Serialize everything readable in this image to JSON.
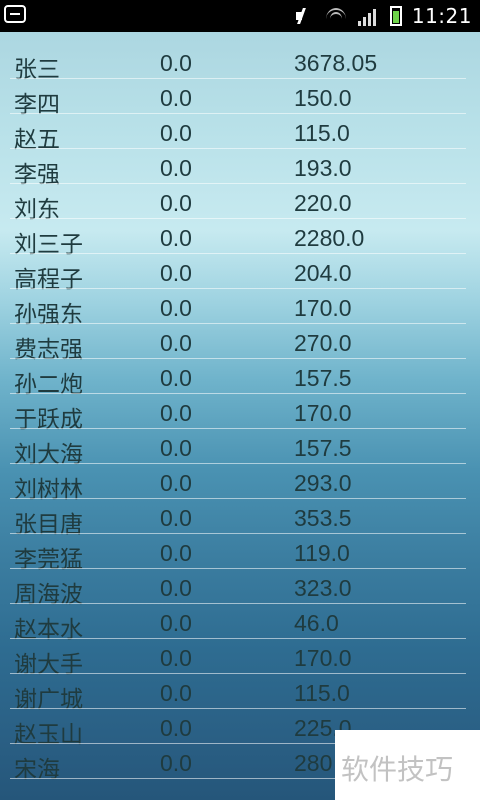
{
  "status_bar": {
    "time": "11:21"
  },
  "rows": [
    {
      "name": "张三",
      "v1": "0.0",
      "v2": "3678.05"
    },
    {
      "name": "李四",
      "v1": "0.0",
      "v2": "150.0"
    },
    {
      "name": "赵五",
      "v1": "0.0",
      "v2": "115.0"
    },
    {
      "name": "李强",
      "v1": "0.0",
      "v2": "193.0"
    },
    {
      "name": "刘东",
      "v1": "0.0",
      "v2": "220.0"
    },
    {
      "name": "刘三子",
      "v1": "0.0",
      "v2": "2280.0"
    },
    {
      "name": "高程子",
      "v1": "0.0",
      "v2": "204.0"
    },
    {
      "name": "孙强东",
      "v1": "0.0",
      "v2": "170.0"
    },
    {
      "name": "费志强",
      "v1": "0.0",
      "v2": "270.0"
    },
    {
      "name": "孙二炮",
      "v1": "0.0",
      "v2": "157.5"
    },
    {
      "name": "于跃成",
      "v1": "0.0",
      "v2": "170.0"
    },
    {
      "name": "刘大海",
      "v1": "0.0",
      "v2": "157.5"
    },
    {
      "name": "刘树林",
      "v1": "0.0",
      "v2": "293.0"
    },
    {
      "name": "张目唐",
      "v1": "0.0",
      "v2": "353.5"
    },
    {
      "name": "李莞猛",
      "v1": "0.0",
      "v2": "119.0"
    },
    {
      "name": "周海波",
      "v1": "0.0",
      "v2": "323.0"
    },
    {
      "name": "赵本水",
      "v1": "0.0",
      "v2": "46.0"
    },
    {
      "name": "谢大手",
      "v1": "0.0",
      "v2": "170.0"
    },
    {
      "name": "谢广城",
      "v1": "0.0",
      "v2": "115.0"
    },
    {
      "name": "赵玉山",
      "v1": "0.0",
      "v2": "225.0"
    },
    {
      "name": "宋海",
      "v1": "0.0",
      "v2": "280"
    }
  ],
  "watermark": {
    "text": "软件技巧"
  }
}
